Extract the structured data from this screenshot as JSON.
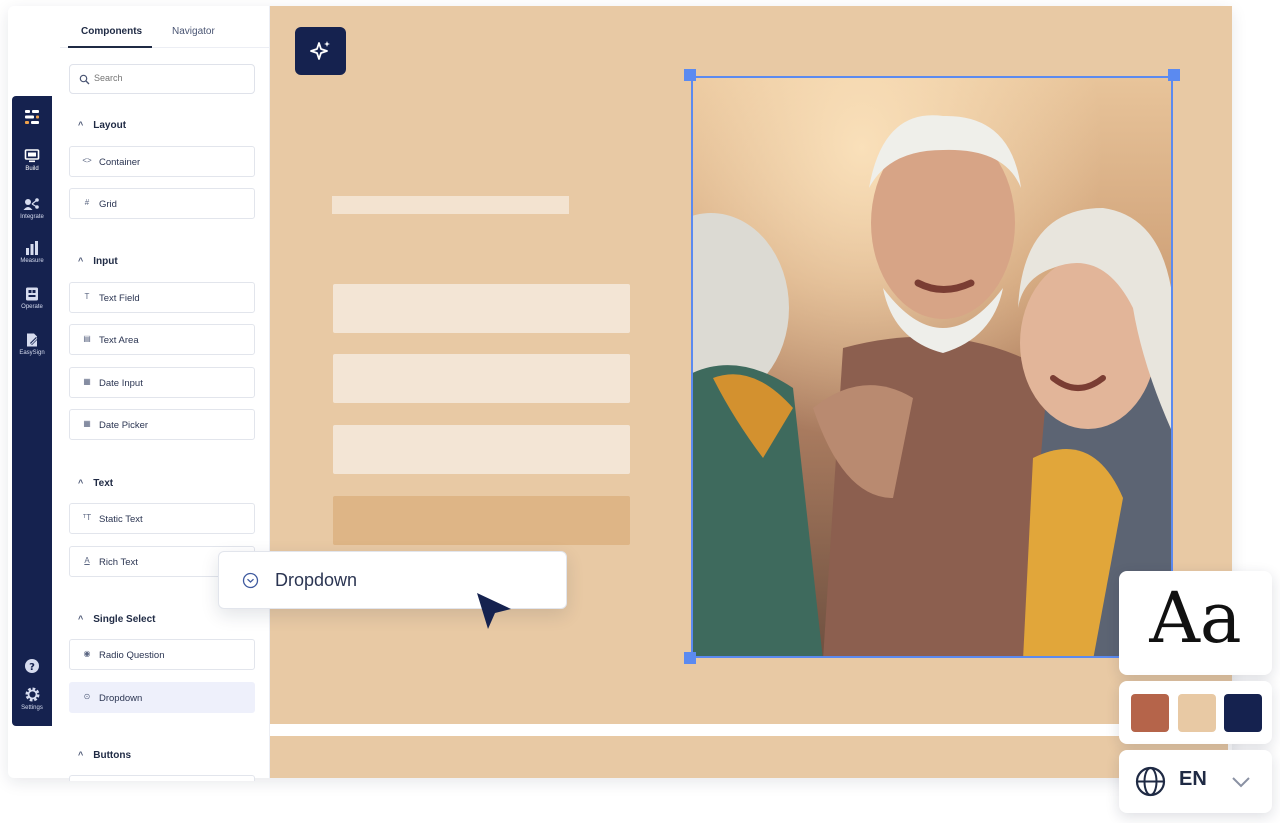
{
  "panel": {
    "tabs": [
      {
        "label": "Components"
      },
      {
        "label": "Navigator"
      }
    ],
    "search": {
      "placeholder": "Search"
    },
    "sections": {
      "layout": {
        "title": "Layout",
        "items": [
          "Container",
          "Grid"
        ]
      },
      "input": {
        "title": "Input",
        "items": [
          "Text Field",
          "Text Area",
          "Date Input",
          "Date Picker"
        ]
      },
      "text": {
        "title": "Text",
        "items": [
          "Static Text",
          "Rich Text"
        ]
      },
      "single_select": {
        "title": "Single Select",
        "items": [
          "Radio Question",
          "Dropdown"
        ]
      },
      "buttons": {
        "title": "Buttons"
      }
    }
  },
  "rail": {
    "items": [
      "Build",
      "Integrate",
      "Measure",
      "Operate",
      "EasySign",
      "Settings"
    ]
  },
  "floating_item": {
    "label": "Dropdown"
  },
  "widgets": {
    "font_sample": "Aa",
    "palette": [
      "#b5644a",
      "#e8c9a4",
      "#15224f"
    ],
    "language": "EN"
  },
  "colors": {
    "canvas": "#e8c9a4",
    "navy": "#15224f",
    "selection": "#5b8af0"
  }
}
